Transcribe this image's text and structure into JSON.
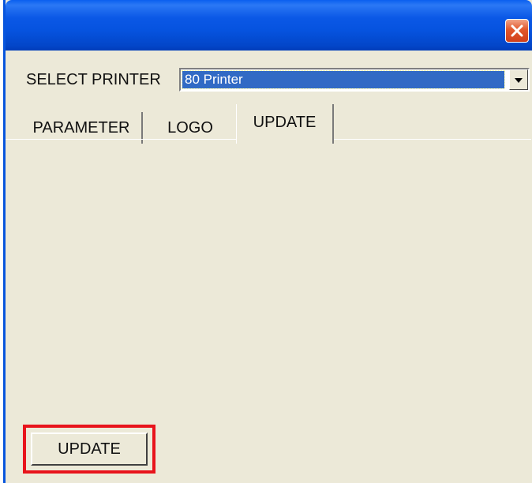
{
  "window": {
    "title": "",
    "close_icon": "close-icon",
    "colors": {
      "titlebar": "#0653df",
      "close": "#e2572b",
      "face": "#ece9d8",
      "highlight": "#e8141c",
      "selection": "#316ac5"
    }
  },
  "printer": {
    "label": "SELECT PRINTER",
    "selected": "80 Printer",
    "arrow_icon": "chevron-down-icon"
  },
  "tabs": [
    {
      "label": "PARAMETER",
      "active": false
    },
    {
      "label": "LOGO",
      "active": false
    },
    {
      "label": "UPDATE",
      "active": true
    }
  ],
  "actions": {
    "update_label": "UPDATE"
  }
}
